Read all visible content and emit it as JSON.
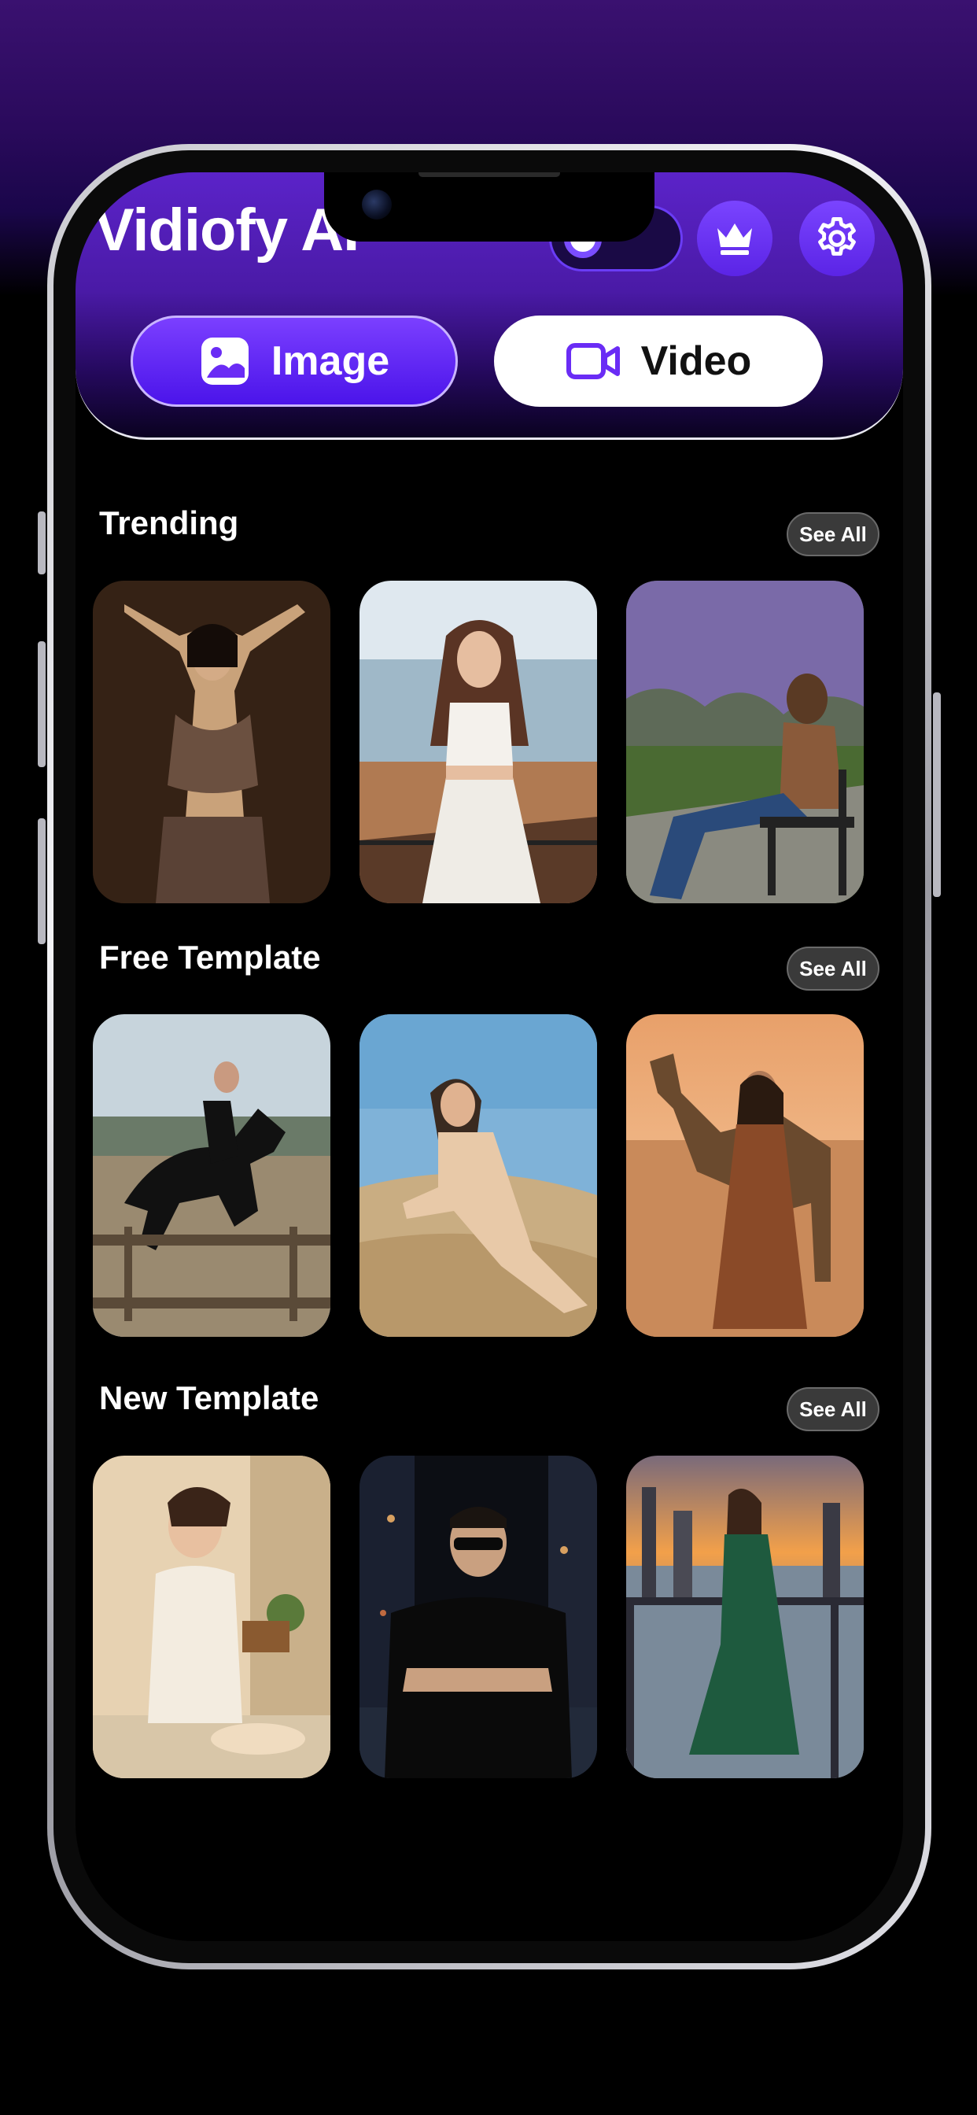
{
  "app": {
    "title": "Vidiofy AI"
  },
  "header": {
    "credits_icon": "credit-coin-icon",
    "premium_icon": "crown-icon",
    "settings_icon": "gear-icon"
  },
  "mode_tabs": [
    {
      "label": "Image",
      "icon": "image-icon",
      "active": true
    },
    {
      "label": "Video",
      "icon": "video-camera-icon",
      "active": false
    }
  ],
  "sections": [
    {
      "title": "Trending",
      "see_all": "See All",
      "cards": [
        {
          "subject": "belly dancer in beaded costume",
          "palette": [
            "#3a2618",
            "#1c110a",
            "#c9a27a",
            "#6b5040"
          ]
        },
        {
          "subject": "woman in white crop top on seaside balcony",
          "palette": [
            "#d8e4ef",
            "#9fb8c8",
            "#f1ece4",
            "#5a3a28"
          ]
        },
        {
          "subject": "man sitting on bench under wisteria",
          "palette": [
            "#7a6aa8",
            "#3d5a2e",
            "#8a5a3a",
            "#2a4a7a"
          ]
        }
      ]
    },
    {
      "title": "Free Template",
      "see_all": "See All",
      "cards": [
        {
          "subject": "rider jumping black horse over fence",
          "palette": [
            "#c7d4dc",
            "#8a9a88",
            "#111111",
            "#9a8a70"
          ]
        },
        {
          "subject": "woman in beige dress on sand dune",
          "palette": [
            "#7fb2d8",
            "#c9ad82",
            "#e8c9a8",
            "#3a2a20"
          ]
        },
        {
          "subject": "woman in brown gown with camel in desert",
          "palette": [
            "#e8a06a",
            "#c98a5a",
            "#8a4a28",
            "#6a4a2e"
          ]
        }
      ]
    },
    {
      "title": "New Template",
      "see_all": "See All",
      "cards": [
        {
          "subject": "woman kneading dough in kitchen",
          "palette": [
            "#e7d2b2",
            "#c9b08a",
            "#f3ece0",
            "#5a3a28"
          ]
        },
        {
          "subject": "man in black t-shirt and sunglasses in city street",
          "palette": [
            "#2a3040",
            "#0c0e14",
            "#c9a080",
            "#d8a060"
          ]
        },
        {
          "subject": "woman in green dress on city rooftop at sunset",
          "palette": [
            "#f2a04a",
            "#7a8a9a",
            "#1e5a3e",
            "#3a3a44"
          ]
        }
      ]
    }
  ]
}
